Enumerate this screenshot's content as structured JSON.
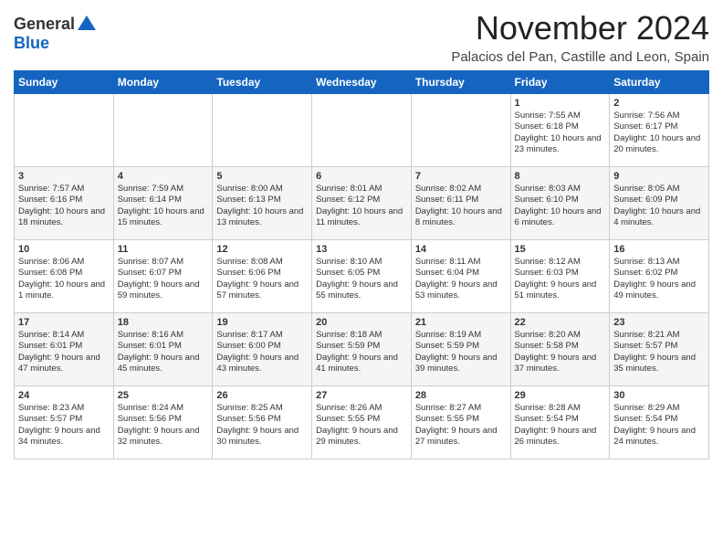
{
  "header": {
    "logo_general": "General",
    "logo_blue": "Blue",
    "month_title": "November 2024",
    "location": "Palacios del Pan, Castille and Leon, Spain"
  },
  "weekdays": [
    "Sunday",
    "Monday",
    "Tuesday",
    "Wednesday",
    "Thursday",
    "Friday",
    "Saturday"
  ],
  "weeks": [
    [
      {
        "day": "",
        "content": ""
      },
      {
        "day": "",
        "content": ""
      },
      {
        "day": "",
        "content": ""
      },
      {
        "day": "",
        "content": ""
      },
      {
        "day": "",
        "content": ""
      },
      {
        "day": "1",
        "content": "Sunrise: 7:55 AM\nSunset: 6:18 PM\nDaylight: 10 hours and 23 minutes."
      },
      {
        "day": "2",
        "content": "Sunrise: 7:56 AM\nSunset: 6:17 PM\nDaylight: 10 hours and 20 minutes."
      }
    ],
    [
      {
        "day": "3",
        "content": "Sunrise: 7:57 AM\nSunset: 6:16 PM\nDaylight: 10 hours and 18 minutes."
      },
      {
        "day": "4",
        "content": "Sunrise: 7:59 AM\nSunset: 6:14 PM\nDaylight: 10 hours and 15 minutes."
      },
      {
        "day": "5",
        "content": "Sunrise: 8:00 AM\nSunset: 6:13 PM\nDaylight: 10 hours and 13 minutes."
      },
      {
        "day": "6",
        "content": "Sunrise: 8:01 AM\nSunset: 6:12 PM\nDaylight: 10 hours and 11 minutes."
      },
      {
        "day": "7",
        "content": "Sunrise: 8:02 AM\nSunset: 6:11 PM\nDaylight: 10 hours and 8 minutes."
      },
      {
        "day": "8",
        "content": "Sunrise: 8:03 AM\nSunset: 6:10 PM\nDaylight: 10 hours and 6 minutes."
      },
      {
        "day": "9",
        "content": "Sunrise: 8:05 AM\nSunset: 6:09 PM\nDaylight: 10 hours and 4 minutes."
      }
    ],
    [
      {
        "day": "10",
        "content": "Sunrise: 8:06 AM\nSunset: 6:08 PM\nDaylight: 10 hours and 1 minute."
      },
      {
        "day": "11",
        "content": "Sunrise: 8:07 AM\nSunset: 6:07 PM\nDaylight: 9 hours and 59 minutes."
      },
      {
        "day": "12",
        "content": "Sunrise: 8:08 AM\nSunset: 6:06 PM\nDaylight: 9 hours and 57 minutes."
      },
      {
        "day": "13",
        "content": "Sunrise: 8:10 AM\nSunset: 6:05 PM\nDaylight: 9 hours and 55 minutes."
      },
      {
        "day": "14",
        "content": "Sunrise: 8:11 AM\nSunset: 6:04 PM\nDaylight: 9 hours and 53 minutes."
      },
      {
        "day": "15",
        "content": "Sunrise: 8:12 AM\nSunset: 6:03 PM\nDaylight: 9 hours and 51 minutes."
      },
      {
        "day": "16",
        "content": "Sunrise: 8:13 AM\nSunset: 6:02 PM\nDaylight: 9 hours and 49 minutes."
      }
    ],
    [
      {
        "day": "17",
        "content": "Sunrise: 8:14 AM\nSunset: 6:01 PM\nDaylight: 9 hours and 47 minutes."
      },
      {
        "day": "18",
        "content": "Sunrise: 8:16 AM\nSunset: 6:01 PM\nDaylight: 9 hours and 45 minutes."
      },
      {
        "day": "19",
        "content": "Sunrise: 8:17 AM\nSunset: 6:00 PM\nDaylight: 9 hours and 43 minutes."
      },
      {
        "day": "20",
        "content": "Sunrise: 8:18 AM\nSunset: 5:59 PM\nDaylight: 9 hours and 41 minutes."
      },
      {
        "day": "21",
        "content": "Sunrise: 8:19 AM\nSunset: 5:59 PM\nDaylight: 9 hours and 39 minutes."
      },
      {
        "day": "22",
        "content": "Sunrise: 8:20 AM\nSunset: 5:58 PM\nDaylight: 9 hours and 37 minutes."
      },
      {
        "day": "23",
        "content": "Sunrise: 8:21 AM\nSunset: 5:57 PM\nDaylight: 9 hours and 35 minutes."
      }
    ],
    [
      {
        "day": "24",
        "content": "Sunrise: 8:23 AM\nSunset: 5:57 PM\nDaylight: 9 hours and 34 minutes."
      },
      {
        "day": "25",
        "content": "Sunrise: 8:24 AM\nSunset: 5:56 PM\nDaylight: 9 hours and 32 minutes."
      },
      {
        "day": "26",
        "content": "Sunrise: 8:25 AM\nSunset: 5:56 PM\nDaylight: 9 hours and 30 minutes."
      },
      {
        "day": "27",
        "content": "Sunrise: 8:26 AM\nSunset: 5:55 PM\nDaylight: 9 hours and 29 minutes."
      },
      {
        "day": "28",
        "content": "Sunrise: 8:27 AM\nSunset: 5:55 PM\nDaylight: 9 hours and 27 minutes."
      },
      {
        "day": "29",
        "content": "Sunrise: 8:28 AM\nSunset: 5:54 PM\nDaylight: 9 hours and 26 minutes."
      },
      {
        "day": "30",
        "content": "Sunrise: 8:29 AM\nSunset: 5:54 PM\nDaylight: 9 hours and 24 minutes."
      }
    ]
  ]
}
